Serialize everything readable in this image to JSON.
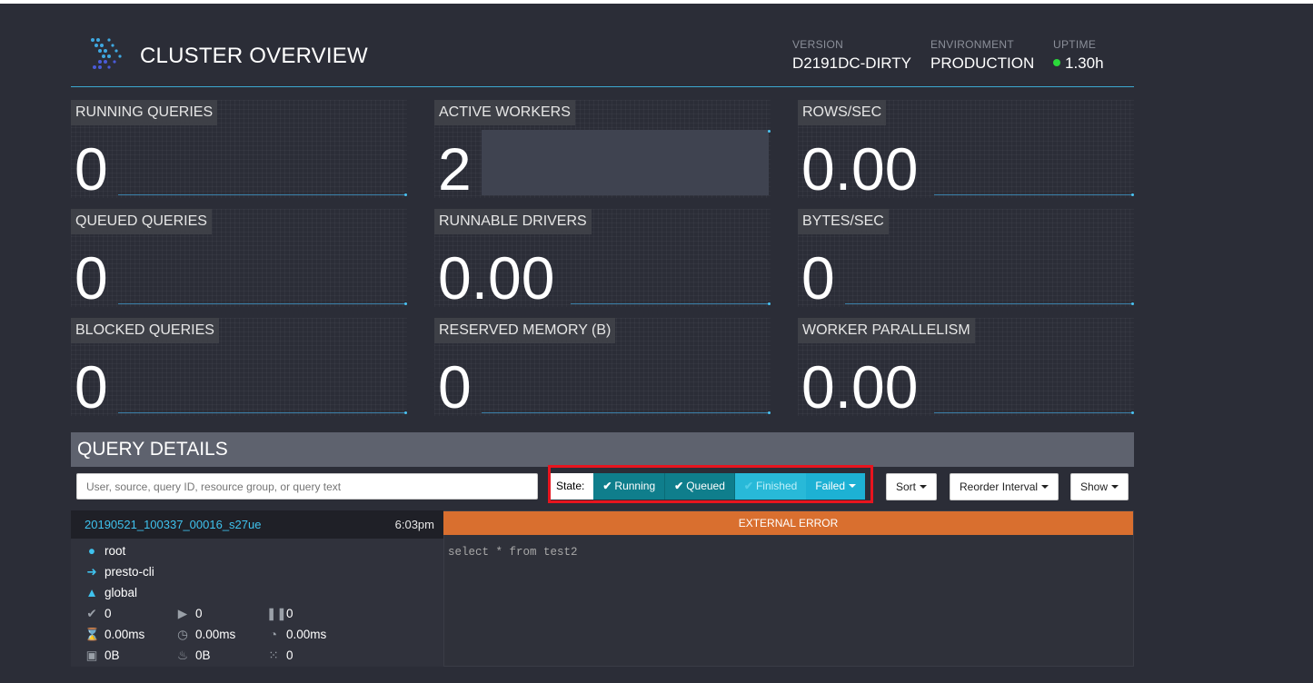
{
  "header": {
    "title": "CLUSTER OVERVIEW",
    "version_label": "VERSION",
    "version_value": "D2191DC-DIRTY",
    "environment_label": "ENVIRONMENT",
    "environment_value": "PRODUCTION",
    "uptime_label": "UPTIME",
    "uptime_value": "1.30h"
  },
  "tiles": [
    {
      "label": "RUNNING QUERIES",
      "value": "0"
    },
    {
      "label": "ACTIVE WORKERS",
      "value": "2"
    },
    {
      "label": "ROWS/SEC",
      "value": "0.00"
    },
    {
      "label": "QUEUED QUERIES",
      "value": "0"
    },
    {
      "label": "RUNNABLE DRIVERS",
      "value": "0.00"
    },
    {
      "label": "BYTES/SEC",
      "value": "0"
    },
    {
      "label": "BLOCKED QUERIES",
      "value": "0"
    },
    {
      "label": "RESERVED MEMORY (B)",
      "value": "0"
    },
    {
      "label": "WORKER PARALLELISM",
      "value": "0.00"
    }
  ],
  "query_details": {
    "title": "QUERY DETAILS",
    "search_placeholder": "User, source, query ID, resource group, or query text",
    "state_label": "State:",
    "states": {
      "running": "Running",
      "queued": "Queued",
      "finished": "Finished",
      "failed": "Failed"
    },
    "sort_label": "Sort",
    "reorder_label": "Reorder Interval",
    "show_label": "Show"
  },
  "query": {
    "id": "20190521_100337_00016_s27ue",
    "time": "6:03pm",
    "status": "EXTERNAL ERROR",
    "user": "root",
    "source": "presto-cli",
    "resource_group": "global",
    "completed_splits": "0",
    "running_splits": "0",
    "queued_splits": "0",
    "wall_time": "0.00ms",
    "elapsed_time": "0.00ms",
    "cpu_time": "0.00ms",
    "current_memory": "0B",
    "peak_memory": "0B",
    "cumulative": "0",
    "sql": "select * from test2"
  },
  "colors": {
    "background": "#2b2d37",
    "accent": "#3fc2ee",
    "error": "#d96f2f",
    "highlight_box": "#e8141e",
    "uptime_dot": "#2bd93a"
  }
}
